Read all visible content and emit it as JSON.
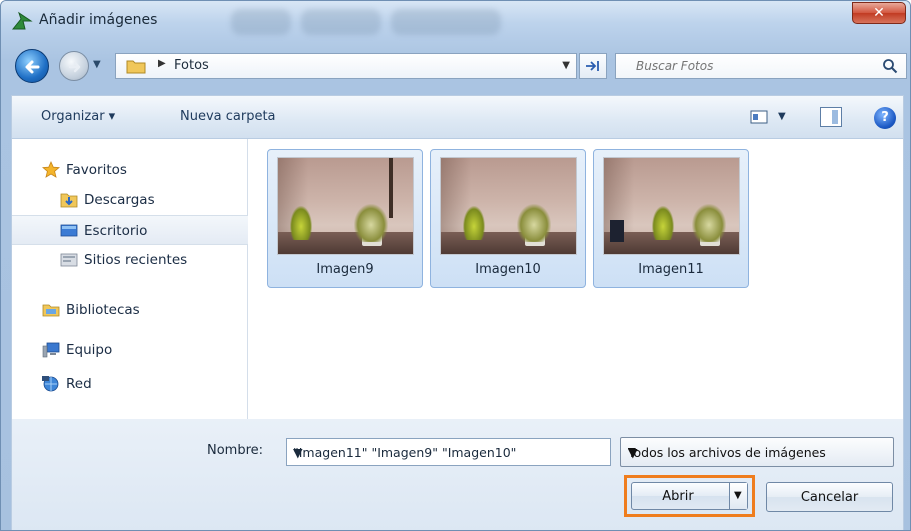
{
  "window": {
    "title": "Añadir imágenes",
    "close_label": "✕"
  },
  "navigation": {
    "path_segment": "Fotos",
    "search_placeholder": "Buscar Fotos"
  },
  "toolbar": {
    "organize_label": "Organizar ▾",
    "new_folder_label": "Nueva carpeta",
    "help_label": "?"
  },
  "sidebar": {
    "items": [
      {
        "label": "Favoritos",
        "icon": "star-icon"
      },
      {
        "label": "Descargas",
        "icon": "downloads-folder-icon"
      },
      {
        "label": "Escritorio",
        "icon": "desktop-icon"
      },
      {
        "label": "Sitios recientes",
        "icon": "recent-places-icon"
      },
      {
        "label": "Bibliotecas",
        "icon": "libraries-icon"
      },
      {
        "label": "Equipo",
        "icon": "computer-icon"
      },
      {
        "label": "Red",
        "icon": "network-icon"
      }
    ],
    "selected": "Escritorio"
  },
  "files": [
    {
      "name": "Imagen9"
    },
    {
      "name": "Imagen10"
    },
    {
      "name": "Imagen11"
    }
  ],
  "footer": {
    "name_label": "Nombre:",
    "name_value": "\"Imagen11\" \"Imagen9\" \"Imagen10\"",
    "filter_value": "Todos los archivos de imágenes",
    "open_label": "Abrir",
    "cancel_label": "Cancelar"
  },
  "colors": {
    "highlight": "#ef7d1e",
    "accent": "#1f6fc5"
  }
}
